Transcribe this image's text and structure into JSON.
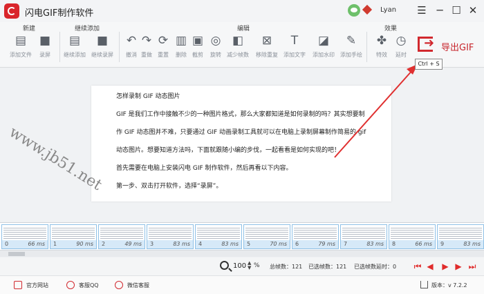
{
  "app": {
    "title": "闪电GIF制作软件",
    "user": "Lyan"
  },
  "window_controls": {
    "menu": "☰",
    "minimize": "─",
    "maximize": "☐",
    "close": "✕"
  },
  "ribbon": {
    "groups": {
      "new": "新建",
      "continue_add": "继续添加",
      "edit": "编辑",
      "effects": "效果"
    },
    "tools": {
      "add_file": "添加文件",
      "record": "录屏",
      "continue_add": "继续添加",
      "continue_record": "继续录屏",
      "undo": "撤消",
      "redo": "重做",
      "reset": "重置",
      "delete": "删除",
      "crop": "截剪",
      "rotate": "旋转",
      "reduce_frames": "减少帧数",
      "remove_duplicate": "移除重复",
      "add_text": "添加文字",
      "add_watermark": "添加水印",
      "add_handwriting": "添加手绘",
      "effects": "特效",
      "delay": "延时"
    },
    "export": {
      "label": "导出GIF",
      "shortcut": "Ctrl + S"
    }
  },
  "document": {
    "lines": [
      "怎样录制 GIF 动态图片",
      "GIF 是我们工作中接触不少的一种图片格式，那么大家都知道是如何录制的吗？其实想要制",
      "作 GIF 动态图并不难，只要通过 GIF 动画录制工具就可以在电脑上录制屏幕制作简易的 gif",
      "动态图片。想要知道方法吗，下面就跟随小编的步伐，一起看看是如何实现的吧！",
      "首先需要在电脑上安装闪电 GIF 制作软件，然后再看以下内容。",
      "第一步、双击打开软件，选择“录屏”。"
    ],
    "watermark": "www.jb51.net"
  },
  "frames": [
    {
      "index": "0",
      "ms": "66 ms"
    },
    {
      "index": "1",
      "ms": "90 ms"
    },
    {
      "index": "2",
      "ms": "49 ms"
    },
    {
      "index": "3",
      "ms": "83 ms"
    },
    {
      "index": "4",
      "ms": "83 ms"
    },
    {
      "index": "5",
      "ms": "70 ms"
    },
    {
      "index": "6",
      "ms": "79 ms"
    },
    {
      "index": "7",
      "ms": "83 ms"
    },
    {
      "index": "8",
      "ms": "66 ms"
    },
    {
      "index": "9",
      "ms": "83 ms"
    }
  ],
  "status": {
    "zoom": "100",
    "zoom_unit": "%",
    "total_frames": "总帧数：121",
    "selected_frames": "已选帧数：121",
    "selected_delay": "已选帧数延时：0",
    "zoom_up": "▲",
    "zoom_down": "▼",
    "controls": [
      "⏮",
      "◀",
      "▶",
      "▶",
      "⏭"
    ]
  },
  "footer": {
    "website": "官方网站",
    "qq": "客服QQ",
    "wechat": "微信客服",
    "version": "版本：v 7.2.2"
  },
  "colors": {
    "accent": "#d1282e",
    "frame_caption": "#d6e9f8"
  }
}
